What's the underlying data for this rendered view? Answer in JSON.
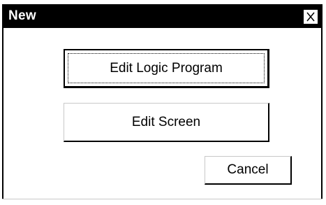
{
  "window": {
    "title": "New",
    "close_icon": "close-icon"
  },
  "buttons": {
    "edit_logic_program": "Edit Logic Program",
    "edit_screen": "Edit Screen",
    "cancel": "Cancel"
  }
}
